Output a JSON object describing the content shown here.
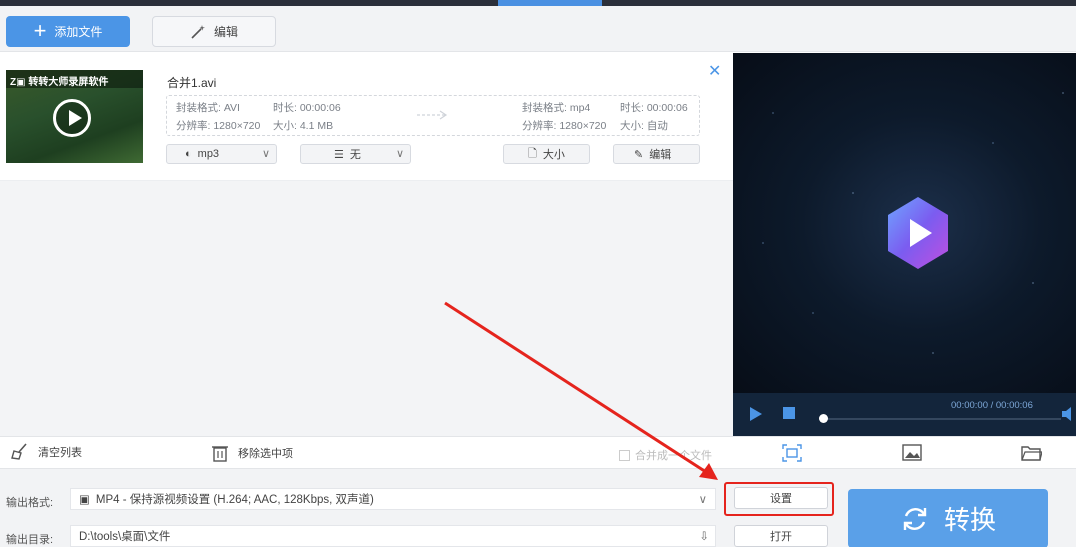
{
  "toolbar": {
    "add_file_label": "添加文件",
    "edit_label": "编辑"
  },
  "file_item": {
    "filename": "合并1.avi",
    "thumbnail_text": "转转大师录屏软件",
    "source": {
      "format": "封装格式: AVI",
      "duration": "时长: 00:00:06",
      "resolution": "分辨率: 1280×720",
      "size": "大小: 4.1 MB"
    },
    "target": {
      "format": "封装格式: mp4",
      "duration": "时长: 00:00:06",
      "resolution": "分辨率: 1280×720",
      "size": "大小: 自动"
    },
    "audio_select": "mp3",
    "subtitle_select": "无",
    "size_button": "大小",
    "edit_button": "编辑"
  },
  "list_actions": {
    "clear_list": "清空列表",
    "remove_selected": "移除选中项",
    "merge_label": "合并成一个文件"
  },
  "player": {
    "time": "00:00:00 / 00:00:06",
    "progress": 0
  },
  "output": {
    "format_label": "输出格式:",
    "format_value": "MP4 - 保持源视频设置 (H.264; AAC, 128Kbps, 双声道)",
    "dir_label": "输出目录:",
    "dir_value": "D:\\tools\\桌面\\文件",
    "settings_button": "设置",
    "open_button": "打开",
    "convert_button": "转换"
  },
  "colors": {
    "accent": "#4b95e6",
    "annotation": "#e5241d"
  }
}
